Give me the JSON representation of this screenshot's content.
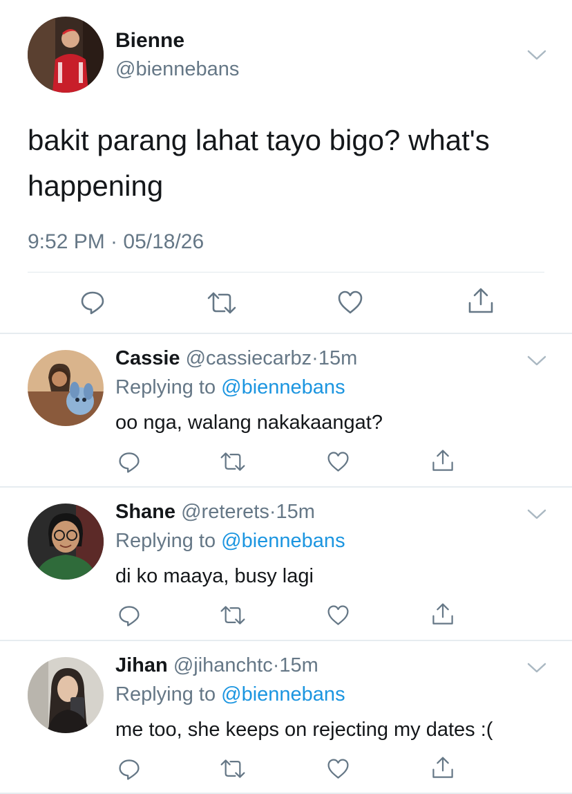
{
  "main_tweet": {
    "author_name": "Bienne",
    "author_handle": "@biennebans",
    "text": "bakit parang lahat tayo bigo? what's happening",
    "timestamp": "9:52 PM · 05/18/26",
    "avatar_icon": "profile-photo-red-shirt",
    "actions": [
      "reply-icon",
      "retweet-icon",
      "like-icon",
      "share-icon"
    ]
  },
  "replies": [
    {
      "name": "Cassie",
      "handle": "@cassiecarbz",
      "dot": "·",
      "time": "15m",
      "replying_prefix": "Replying to ",
      "replying_mention": "@biennebans",
      "text": "oo nga, walang nakakaangat?"
    },
    {
      "name": "Shane",
      "handle": "@reterets",
      "dot": "·",
      "time": "15m",
      "replying_prefix": "Replying to ",
      "replying_mention": "@biennebans",
      "text": "di ko maaya, busy lagi"
    },
    {
      "name": "Jihan",
      "handle": "@jihanchtc",
      "dot": "·",
      "time": "15m",
      "replying_prefix": "Replying to ",
      "replying_mention": "@biennebans",
      "text": "me too, she keeps on rejecting my dates :("
    }
  ],
  "colors": {
    "text_primary": "#14171a",
    "text_secondary": "#657786",
    "mention_blue": "#1b95e0",
    "divider": "#e6ecf0"
  }
}
